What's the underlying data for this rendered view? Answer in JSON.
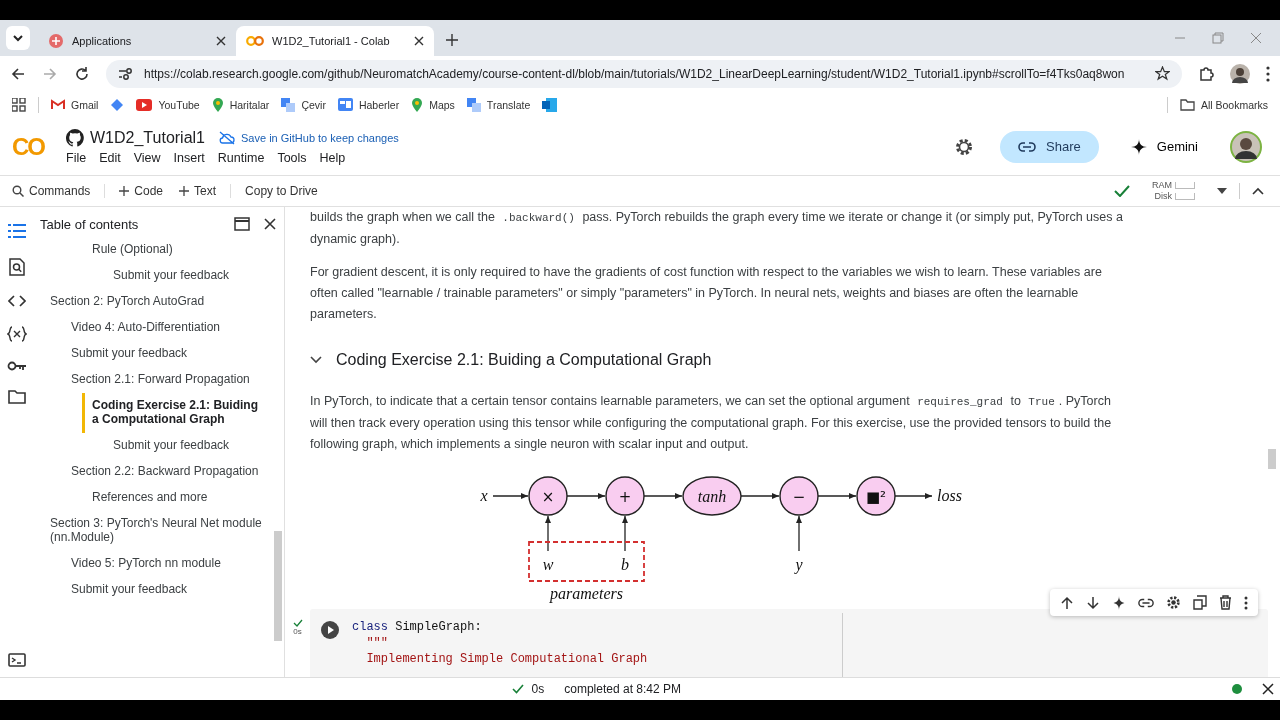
{
  "browser": {
    "tabs": [
      {
        "title": "Applications",
        "selected": false
      },
      {
        "title": "W1D2_Tutorial1 - Colab",
        "selected": true
      }
    ],
    "url": "https://colab.research.google.com/github/NeuromatchAcademy/course-content-dl/blob/main/tutorials/W1D2_LinearDeepLearning/student/W1D2_Tutorial1.ipynb#scrollTo=f4Tks0aq8won",
    "bookmarks": [
      {
        "kind": "labeled",
        "label": "Gmail"
      },
      {
        "kind": "icon_only"
      },
      {
        "kind": "labeled",
        "label": "YouTube"
      },
      {
        "kind": "labeled",
        "label": "Haritalar"
      },
      {
        "kind": "labeled",
        "label": "Çevir"
      },
      {
        "kind": "labeled",
        "label": "Haberler"
      },
      {
        "kind": "labeled",
        "label": "Maps"
      },
      {
        "kind": "labeled",
        "label": "Translate"
      },
      {
        "kind": "icon_only"
      }
    ],
    "all_bookmarks": "All Bookmarks"
  },
  "colab": {
    "logo": "CO",
    "title": "W1D2_Tutorial1",
    "save_hint": "Save in GitHub to keep changes",
    "menu": [
      "File",
      "Edit",
      "View",
      "Insert",
      "Runtime",
      "Tools",
      "Help"
    ],
    "share": "Share",
    "gemini": "Gemini",
    "toolbar": [
      {
        "label": "Commands",
        "kind": "search"
      },
      {
        "label": "Code",
        "kind": "add"
      },
      {
        "label": "Text",
        "kind": "add"
      },
      {
        "label": "Copy to Drive",
        "kind": "plain"
      }
    ],
    "ram": "RAM",
    "disk": "Disk"
  },
  "toc": {
    "title": "Table of contents",
    "partial_top": [
      {
        "title": "Rule (Optional)",
        "selected": false,
        "children": [
          {
            "title": "Submit your feedback",
            "selected": false
          }
        ]
      }
    ],
    "sections": [
      {
        "title": "Section 2: PyTorch AutoGrad",
        "selected": false,
        "children": [
          {
            "title": "Video 4: Auto-Differentiation",
            "selected": false
          },
          {
            "title": "Submit your feedback",
            "selected": false
          },
          {
            "title": "Section 2.1: Forward Propagation",
            "selected": false,
            "children": [
              {
                "title": "Coding Exercise 2.1: Buiding a Computational Graph",
                "selected": true,
                "children": [
                  {
                    "title": "Submit your feedback",
                    "selected": false
                  }
                ]
              }
            ]
          },
          {
            "title": "Section 2.2: Backward Propagation",
            "selected": false,
            "children": [
              {
                "title": "References and more",
                "selected": false
              }
            ]
          }
        ]
      },
      {
        "title": "Section 3: PyTorch's Neural Net module (nn.Module)",
        "selected": false,
        "children": [
          {
            "title": "Video 5: PyTorch nn module",
            "selected": false
          },
          {
            "title": "Submit your feedback",
            "selected": false
          }
        ]
      }
    ]
  },
  "paragraphs_top": [
    [
      {
        "kind": "text",
        "text": "builds the graph when we call the "
      },
      {
        "kind": "code",
        "text": ".backward()"
      },
      {
        "kind": "text",
        "text": " pass. PyTorch rebuilds the graph every time we iterate or change it (or simply put, PyTorch uses a dynamic graph)."
      }
    ],
    [
      {
        "kind": "text",
        "text": "For gradient descent, it is only required to have the gradients of cost function with respect to the variables we wish to learn. These variables are often called \"learnable / trainable parameters\" or simply \"parameters\" in PyTorch. In neural nets, weights and biases are often the learnable parameters."
      }
    ]
  ],
  "heading": {
    "title": "Coding Exercise 2.1: Buiding a Computational Graph",
    "expanded": true
  },
  "paragraphs_bottom": [
    [
      {
        "kind": "text",
        "text": "In PyTorch, to indicate that a certain tensor contains learnable parameters, we can set the optional argument "
      },
      {
        "kind": "code",
        "text": "requires_grad"
      },
      {
        "kind": "text",
        "text": " to "
      },
      {
        "kind": "code",
        "text": "True"
      },
      {
        "kind": "text",
        "text": ". PyTorch will then track every operation using this tensor while configuring the computational graph. For this exercise, use the provided tensors to build the following graph, which implements a single neuron with scalar input and output."
      }
    ]
  ],
  "diagram": {
    "input": "x",
    "output": "loss",
    "group_label": "parameters",
    "nodes": [
      {
        "label": "×",
        "kind": "circle",
        "side_input": {
          "label": "w",
          "kind": "parameter"
        }
      },
      {
        "label": "+",
        "kind": "circle",
        "side_input": {
          "label": "b",
          "kind": "parameter"
        }
      },
      {
        "label": "tanh",
        "kind": "ellipse"
      },
      {
        "label": "−",
        "kind": "circle",
        "side_input": {
          "label": "y",
          "kind": "target"
        }
      },
      {
        "label": "■²",
        "kind": "circle"
      }
    ]
  },
  "code_cell": {
    "run_time": "0s",
    "lines": [
      [
        {
          "kind": "keyword",
          "text": "class"
        },
        {
          "kind": "plain",
          "text": " SimpleGraph:"
        }
      ],
      [
        {
          "kind": "string",
          "text": "  \"\"\""
        }
      ],
      [
        {
          "kind": "string",
          "text": "  Implementing Simple Computational Graph"
        }
      ]
    ]
  },
  "status": {
    "time": "0s",
    "message": "completed at 8:42 PM"
  }
}
